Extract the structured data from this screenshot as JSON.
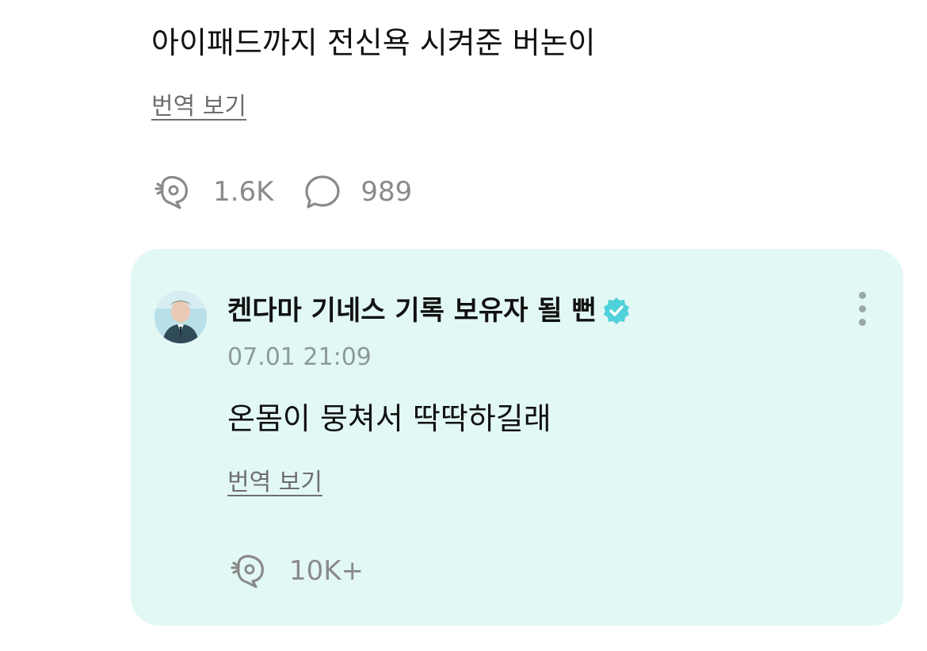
{
  "post": {
    "text": "아이패드까지 전신욕 시켜준 버논이",
    "translate_label": "번역 보기",
    "likes": "1.6K",
    "comments": "989"
  },
  "reply": {
    "username": "켄다마 기네스 기록 보유자 될 뻔",
    "timestamp": "07.01 21:09",
    "text": "온몸이 뭉쳐서 딱딱하길래",
    "translate_label": "번역 보기",
    "likes": "10K+",
    "verified_color": "#4fd1d9",
    "card_color": "#e2f8f5"
  },
  "icons": {
    "like": "like-bubble-icon",
    "comment": "comment-bubble-icon",
    "verified": "verified-badge-icon",
    "more": "more-vertical-icon"
  }
}
